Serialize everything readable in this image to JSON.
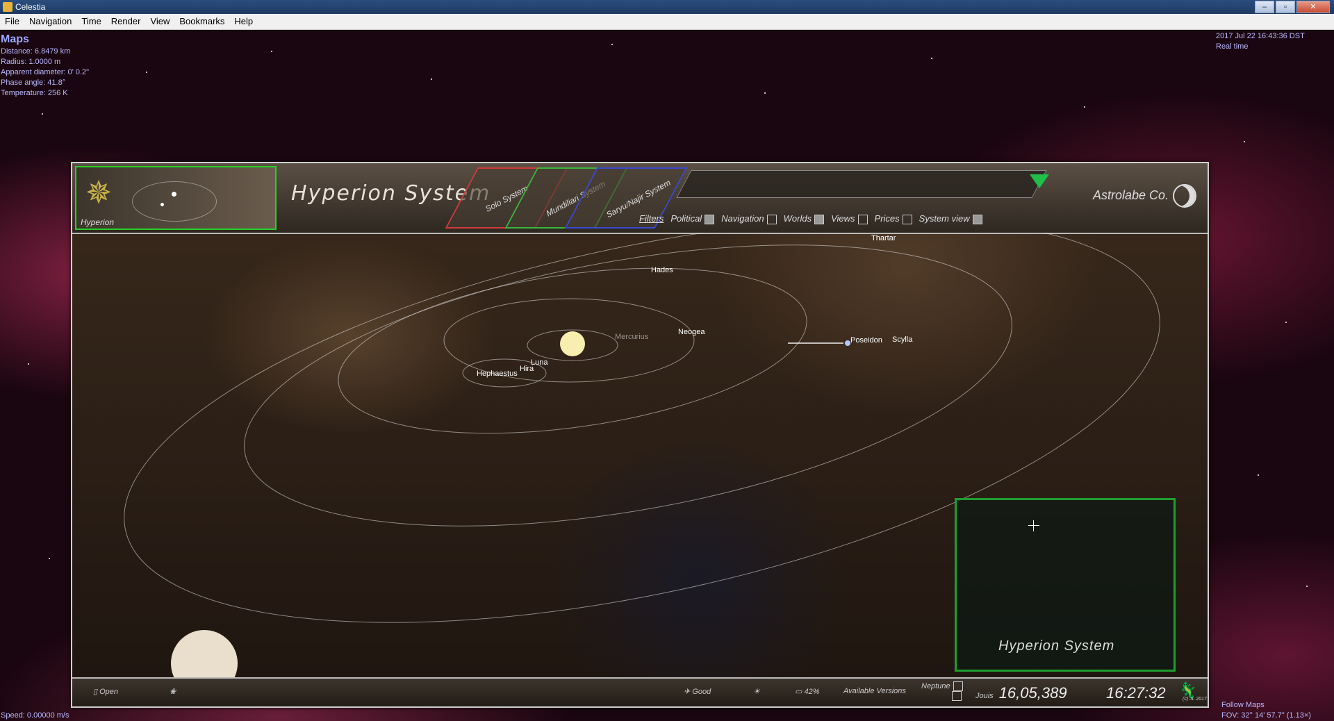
{
  "window": {
    "title": "Celestia",
    "controls": [
      "–",
      "▫",
      "✕"
    ]
  },
  "menu": [
    "File",
    "Navigation",
    "Time",
    "Render",
    "View",
    "Bookmarks",
    "Help"
  ],
  "hud": {
    "object_name": "Maps",
    "distance": "Distance: 6.8479 km",
    "radius": "Radius: 1.0000 m",
    "apparent_diameter": "Apparent diameter: 0' 0.2\"",
    "phase_angle": "Phase angle: 41.8°",
    "temperature": "Temperature: 256 K",
    "datetime": "2017 Jul 22 16:43:36 DST",
    "time_mode": "Real time",
    "speed": "Speed: 0.00000 m/s",
    "follow": "Follow Maps",
    "fov": "FOV: 32° 14' 57.7\" (1.13×)"
  },
  "map": {
    "tile_label": "Hyperion",
    "title": "Hyperion System",
    "tabs": [
      "Solo System",
      "Mundiliari System",
      "Saryu/Najir System"
    ],
    "filters_title": "Filters",
    "filters": [
      {
        "label": "Political",
        "checked": true
      },
      {
        "label": "Navigation",
        "checked": false
      },
      {
        "label": "Worlds",
        "checked": true
      },
      {
        "label": "Views",
        "checked": false
      },
      {
        "label": "Prices",
        "checked": false
      },
      {
        "label": "System view",
        "checked": true
      }
    ],
    "brand": "Astrolabe Co.",
    "planets": [
      {
        "name": "Thartar"
      },
      {
        "name": "Hades"
      },
      {
        "name": "Neogea"
      },
      {
        "name": "Mercurius"
      },
      {
        "name": "Luna"
      },
      {
        "name": "Hira"
      },
      {
        "name": "Hephaestus"
      },
      {
        "name": "Poseidon"
      },
      {
        "name": "Scylla"
      }
    ],
    "inset_title": "Hyperion System",
    "footer": {
      "open": "Open",
      "signal": "Good",
      "battery": "42%",
      "versions": "Available Versions",
      "neptune": "Neptune",
      "jouis_label": "Jouis",
      "jouis_value": "16,05,389",
      "time": "16:27:32",
      "credit": "(c) JL 2017"
    }
  },
  "colors": {
    "hud_text": "#b9b9ff",
    "tile_border": "#26d126",
    "inset_border": "#1f9e2f"
  }
}
